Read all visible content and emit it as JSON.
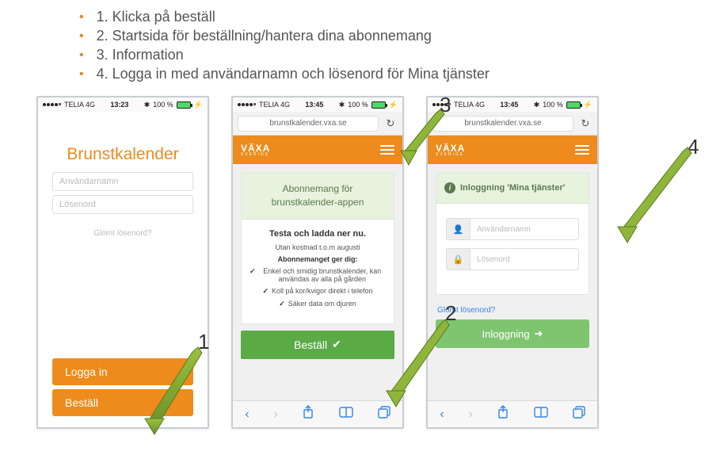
{
  "bullets": [
    "1. Klicka på beställ",
    "2. Startsida för beställning/hantera dina abonnemang",
    "3. Information",
    "4. Logga in med användarnamn och lösenord för Mina tjänster"
  ],
  "status": {
    "carrier": "TELIA  4G",
    "battery": "100 %",
    "bt": "✱"
  },
  "times": {
    "p1": "13:23",
    "p2": "13:45",
    "p3": "13:45"
  },
  "addr": "brunstkalender.vxa.se",
  "vaxa": {
    "name": "VÄXA",
    "sub": "SVERIGE"
  },
  "p1": {
    "title": "Brunstkalender",
    "user_ph": "Användarnamn",
    "pass_ph": "Lösenord",
    "forgot": "Glömt lösenord?",
    "login": "Logga in",
    "order": "Beställ"
  },
  "p2": {
    "head_l1": "Abonnemang för",
    "head_l2": "brunstkalender-appen",
    "test": "Testa och ladda ner nu.",
    "nocost": "Utan kostnad t.o.m augusti",
    "gives": "Abonnemanget ger dig:",
    "b1": "Enkel och smidig brunstkalender, kan användas av alla på gården",
    "b2": "Koll på kor/kvigor direkt i telefon",
    "b3": "Säker data om djuren",
    "order": "Beställ"
  },
  "p3": {
    "head": "Inloggning 'Mina tjänster'",
    "user_ph": "Användarnamn",
    "pass_ph": "Lösenord",
    "forgot": "Glömt lösenord?",
    "login": "Inloggning"
  },
  "ann": {
    "n1": "1",
    "n2": "2",
    "n3": "3",
    "n4": "4"
  }
}
